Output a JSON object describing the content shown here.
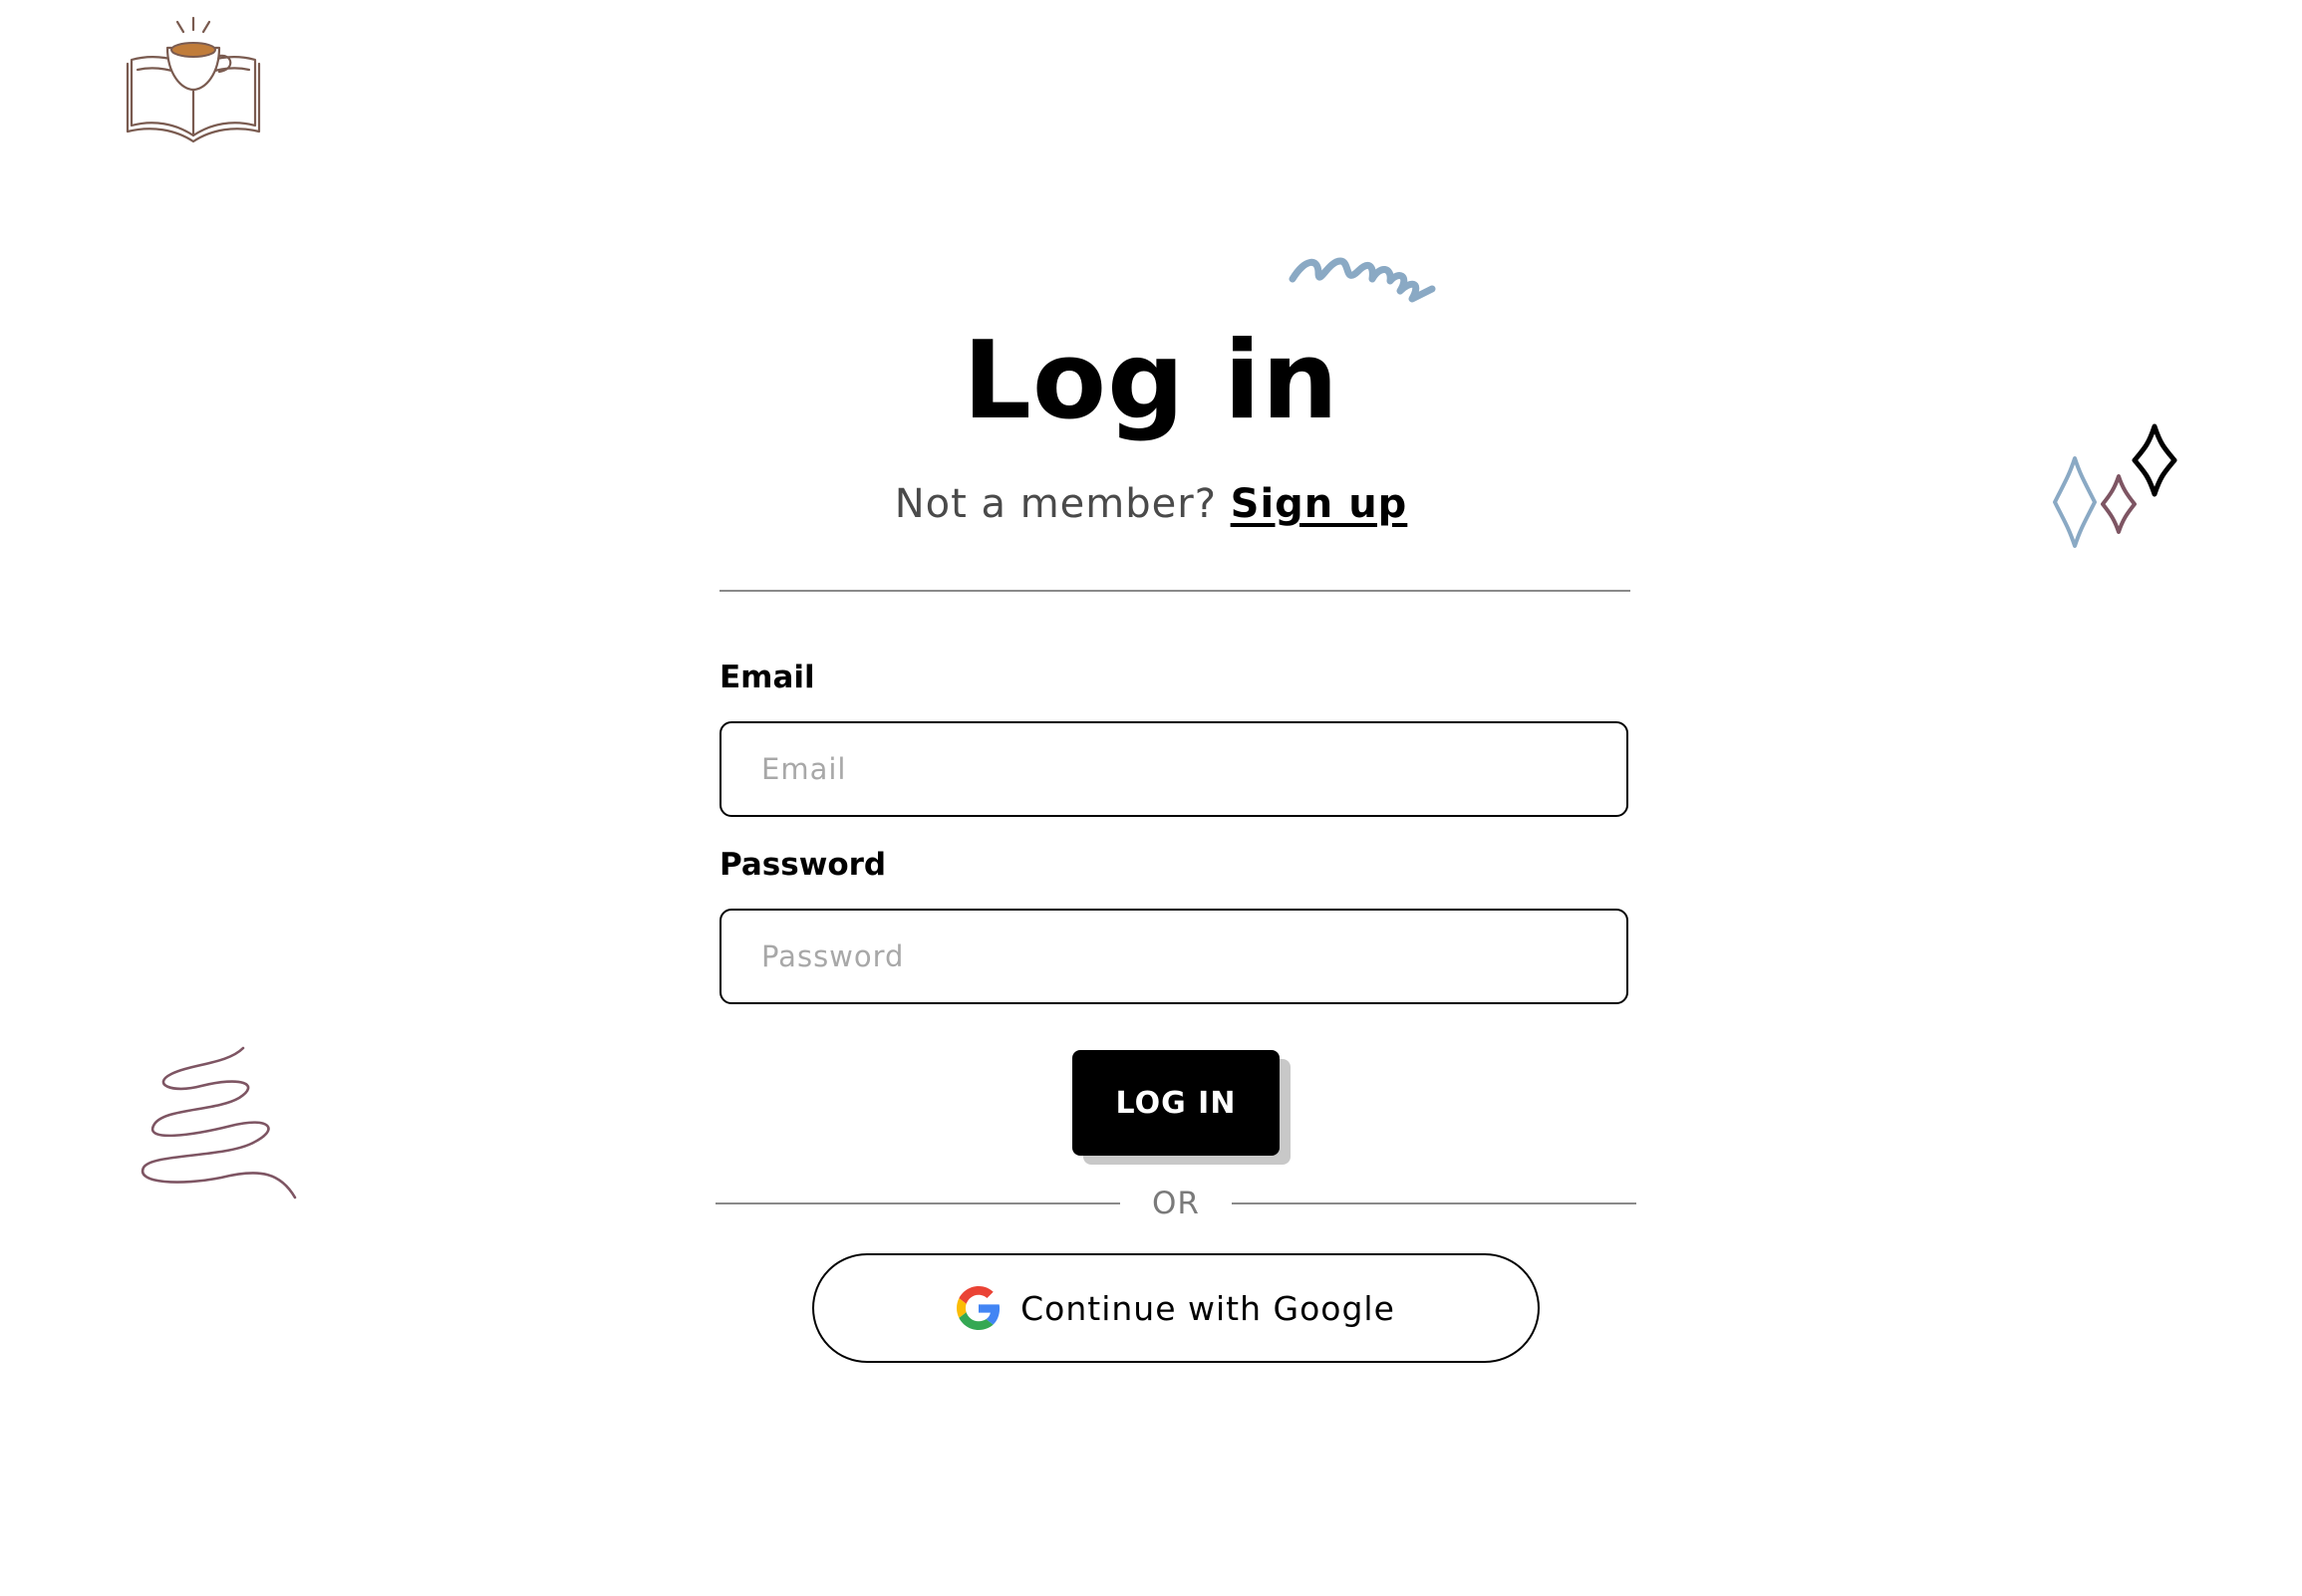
{
  "logo": {
    "icon": "book-coffee-icon"
  },
  "title": "Log in",
  "signup": {
    "prompt": "Not a member?",
    "link_label": "Sign up"
  },
  "form": {
    "email": {
      "label": "Email",
      "placeholder": "Email",
      "value": ""
    },
    "password": {
      "label": "Password",
      "placeholder": "Password",
      "value": ""
    },
    "submit_label": "LOG IN"
  },
  "divider": {
    "text": "OR"
  },
  "google": {
    "label": "Continue with Google",
    "icon": "google-icon"
  },
  "decorations": {
    "scribble": "squiggle-icon",
    "sparkles": "sparkles-icon",
    "spiral": "spiral-scribble-icon"
  },
  "colors": {
    "accent_blue": "#8aa9c4",
    "accent_mauve": "#7e5563",
    "logo_brown": "#7a5b50",
    "coffee": "#c07c3a"
  }
}
